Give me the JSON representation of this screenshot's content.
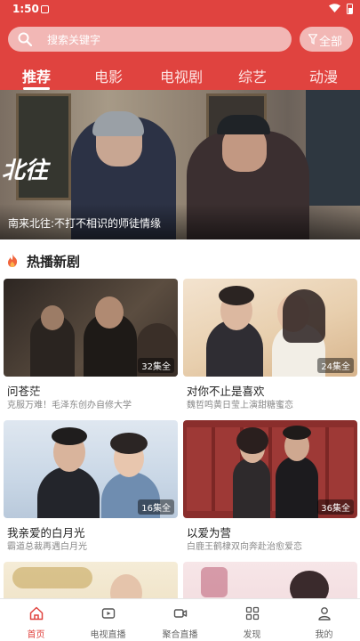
{
  "status_bar": {
    "time": "1:50"
  },
  "search": {
    "placeholder": "搜索关键字"
  },
  "filter_button": {
    "label": "全部"
  },
  "tabs": [
    {
      "label": "推荐",
      "active": true
    },
    {
      "label": "电影"
    },
    {
      "label": "电视剧"
    },
    {
      "label": "综艺"
    },
    {
      "label": "动漫"
    }
  ],
  "banner": {
    "overlay_text": "北往",
    "caption": "南来北往:不打不相识的师徒情缘"
  },
  "section": {
    "title": "热播新剧"
  },
  "shows": [
    {
      "title": "问苍茫",
      "subtitle": "克服万难！毛泽东创办自修大学",
      "episodes": "32集全"
    },
    {
      "title": "对你不止是喜欢",
      "subtitle": "魏哲鸣黄日莹上演甜糖蜜恋",
      "episodes": "24集全"
    },
    {
      "title": "我亲爱的白月光",
      "subtitle": "霸道总裁再遇白月光",
      "episodes": "16集全"
    },
    {
      "title": "以爱为营",
      "subtitle": "白鹿王鹤棣双向奔赴治愈爱恋",
      "episodes": "36集全"
    }
  ],
  "bottom_nav": [
    {
      "label": "首页",
      "icon": "home-icon",
      "active": true
    },
    {
      "label": "电视直播",
      "icon": "tv-icon"
    },
    {
      "label": "聚合直播",
      "icon": "video-camera-icon"
    },
    {
      "label": "发现",
      "icon": "grid-icon"
    },
    {
      "label": "我的",
      "icon": "user-icon"
    }
  ],
  "colors": {
    "accent": "#e0433f",
    "search_bg": "#f2b7b5"
  }
}
